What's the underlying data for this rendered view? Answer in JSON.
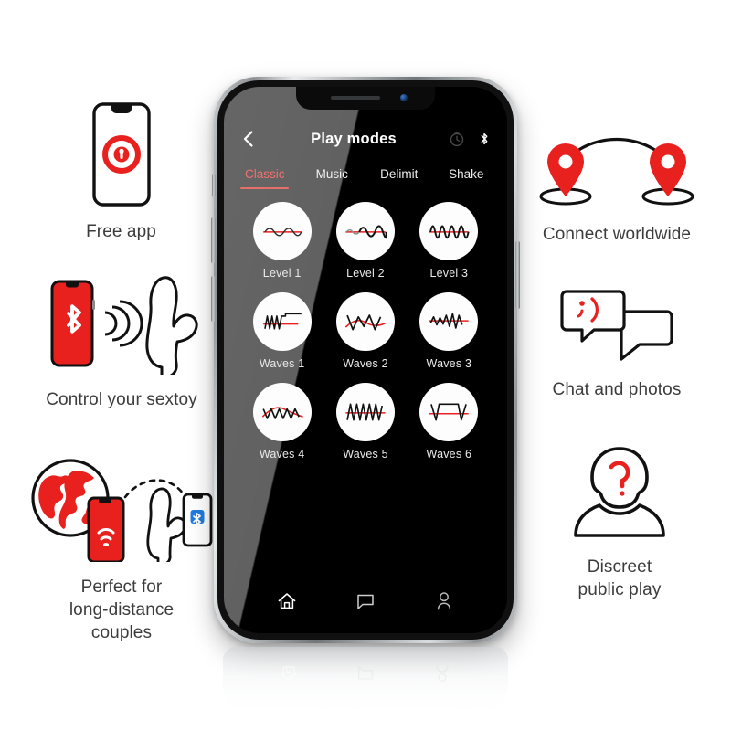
{
  "phone": {
    "header": {
      "back_icon": "chevron-left-icon",
      "title": "Play modes",
      "timer_icon": "timer-icon",
      "bluetooth_icon": "bluetooth-icon"
    },
    "tabs": [
      {
        "label": "Classic",
        "active": true
      },
      {
        "label": "Music",
        "active": false
      },
      {
        "label": "Delimit",
        "active": false
      },
      {
        "label": "Shake",
        "active": false
      }
    ],
    "modes": [
      {
        "label": "Level 1",
        "icon": "wave-level-1-icon"
      },
      {
        "label": "Level 2",
        "icon": "wave-level-2-icon"
      },
      {
        "label": "Level 3",
        "icon": "wave-level-3-icon"
      },
      {
        "label": "Waves 1",
        "icon": "wave-pattern-1-icon"
      },
      {
        "label": "Waves 2",
        "icon": "wave-pattern-2-icon"
      },
      {
        "label": "Waves 3",
        "icon": "wave-pattern-3-icon"
      },
      {
        "label": "Waves 4",
        "icon": "wave-pattern-4-icon"
      },
      {
        "label": "Waves 5",
        "icon": "wave-pattern-5-icon"
      },
      {
        "label": "Waves 6",
        "icon": "wave-pattern-6-icon"
      }
    ],
    "bottom_nav": [
      {
        "icon": "home-icon"
      },
      {
        "icon": "chat-bubble-icon"
      },
      {
        "icon": "user-profile-icon"
      }
    ]
  },
  "features": {
    "free_app": {
      "caption": "Free app",
      "icon": "phone-lock-icon"
    },
    "control_sextoy": {
      "caption": "Control your sextoy",
      "icon": "phone-bluetooth-toy-icon"
    },
    "long_distance": {
      "caption_lines": [
        "Perfect for",
        "long-distance",
        "couples"
      ],
      "icon": "globe-phone-toy-icon"
    },
    "connect_worldwide": {
      "caption": "Connect worldwide",
      "icon": "map-pins-arc-icon"
    },
    "chat_photos": {
      "caption": "Chat and photos",
      "icon": "speech-bubbles-wink-icon",
      "emoticon": ";)"
    },
    "discreet_public": {
      "caption_lines": [
        "Discreet",
        "public play"
      ],
      "icon": "anonymous-person-icon"
    }
  },
  "colors": {
    "brand_red": "#E8201E",
    "accent_pink": "#E86E6B",
    "bluetooth_blue": "#1E7BE0",
    "screen_black": "#000000",
    "caption_gray": "#3C3C3C"
  }
}
